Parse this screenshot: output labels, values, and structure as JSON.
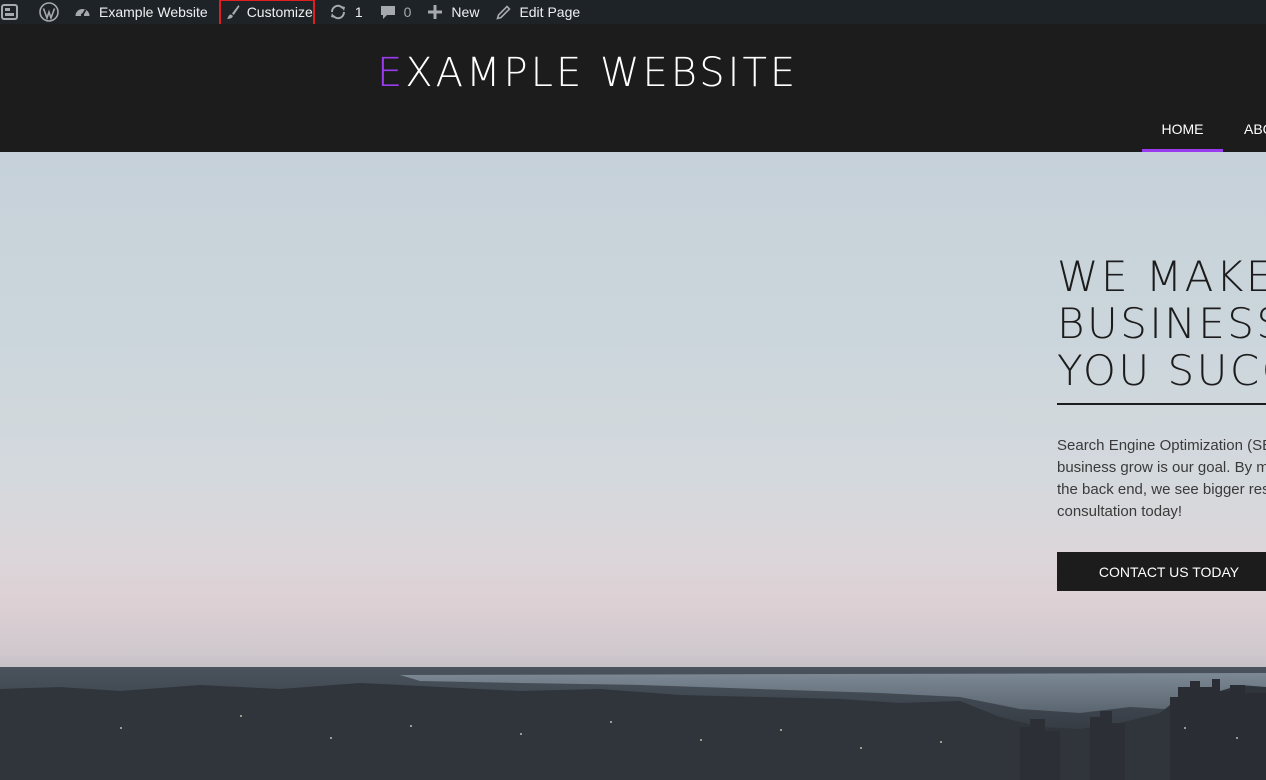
{
  "admin_bar": {
    "site_name": "Example Website",
    "customize_label": "Customize",
    "updates_count": "1",
    "comments_count": "0",
    "new_label": "New",
    "edit_page_label": "Edit Page",
    "icons": [
      "dashboard-icon",
      "wordpress-logo-icon",
      "site-gauge-icon",
      "paintbrush-icon",
      "updates-icon",
      "comment-icon",
      "plus-icon",
      "pencil-icon"
    ],
    "highlight_color": "#e11e1e"
  },
  "header": {
    "title_first_letter": "E",
    "title_rest": "XAMPLE WEBSITE",
    "accent_color": "#9b3bf0",
    "nav": [
      {
        "label": "HOME",
        "active": true
      },
      {
        "label": "ABOUT",
        "active": false
      }
    ]
  },
  "hero": {
    "title_lines": [
      "WE MAKE",
      "BUSINESS",
      "YOU SUCC"
    ],
    "body_lines": [
      "Search Engine Optimization (SEO",
      "business grow is our goal. By ma",
      "the back end, we see bigger resu",
      "consultation today!"
    ],
    "cta_label": "CONTACT US TODAY"
  }
}
